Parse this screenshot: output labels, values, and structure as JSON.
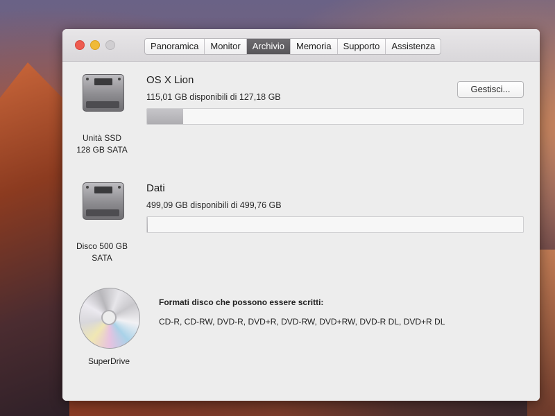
{
  "tabs": [
    {
      "label": "Panoramica"
    },
    {
      "label": "Monitor"
    },
    {
      "label": "Archivio",
      "active": true
    },
    {
      "label": "Memoria"
    },
    {
      "label": "Supporto"
    },
    {
      "label": "Assistenza"
    }
  ],
  "volumes": [
    {
      "name": "OS X Lion",
      "capacity_text": "115,01 GB disponibili di 127,18 GB",
      "used_fraction": 0.096,
      "drive_caption_line1": "Unità SSD",
      "drive_caption_line2": "128 GB SATA",
      "icon": "hard-drive-icon",
      "manage_label": "Gestisci..."
    },
    {
      "name": "Dati",
      "capacity_text": "499,09 GB disponibili di 499,76 GB",
      "used_fraction": 0.0013,
      "drive_caption_line1": "Disco 500 GB",
      "drive_caption_line2": "SATA",
      "icon": "hard-drive-icon"
    }
  ],
  "optical": {
    "caption": "SuperDrive",
    "icon": "cd-disc-icon",
    "formats_heading": "Formati disco che possono essere scritti:",
    "formats_list": "CD-R, CD-RW, DVD-R, DVD+R, DVD-RW, DVD+RW, DVD-R DL, DVD+R DL"
  },
  "colors": {
    "close": "#ee5b50",
    "minimize": "#f0ba37",
    "zoom_disabled": "#d0ced1",
    "active_tab": "#5e5c60"
  }
}
